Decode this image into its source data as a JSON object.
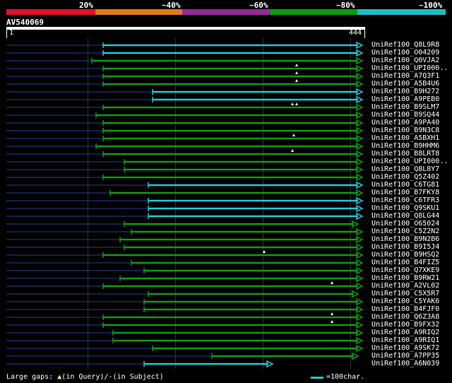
{
  "identity_header": {
    "labels": [
      "20%",
      "~40%",
      "~60%",
      "~80%",
      "~100%"
    ],
    "colors": [
      "#e4102c",
      "#e07a19",
      "#97289a",
      "#0c9a0c",
      "#1dbdc6"
    ]
  },
  "query": {
    "name": "AV540069",
    "start_label": "1",
    "end_label": "444"
  },
  "hits": [
    {
      "name": "UniRef100_Q8L9R8",
      "start": 146,
      "end": 513,
      "color": "cyan",
      "arrow": true
    },
    {
      "name": "UniRef100_O04209",
      "start": 146,
      "end": 513,
      "color": "cyan",
      "arrow": true
    },
    {
      "name": "UniRef100_Q0VJA2",
      "start": 130,
      "end": 513,
      "color": "green",
      "arrow": true
    },
    {
      "name": "UniRef100_UPI000..",
      "start": 146,
      "end": 513,
      "color": "green",
      "arrow": true,
      "marks": [
        420
      ]
    },
    {
      "name": "UniRef100_A7Q3F1",
      "start": 146,
      "end": 513,
      "color": "green",
      "arrow": true,
      "marks": [
        420
      ]
    },
    {
      "name": "UniRef100_A5B4U6",
      "start": 146,
      "end": 513,
      "color": "green",
      "arrow": true,
      "marks": [
        420
      ]
    },
    {
      "name": "UniRef100_B9H272",
      "start": 216,
      "end": 513,
      "color": "cyan",
      "arrow": true
    },
    {
      "name": "UniRef100_A9PEB0",
      "start": 216,
      "end": 513,
      "color": "cyan",
      "arrow": true
    },
    {
      "name": "UniRef100_B9SLM7",
      "start": 146,
      "end": 513,
      "color": "green",
      "arrow": true,
      "marks": [
        414,
        420
      ]
    },
    {
      "name": "UniRef100_B9SQ44",
      "start": 136,
      "end": 513,
      "color": "green",
      "arrow": true
    },
    {
      "name": "UniRef100_A9PA40",
      "start": 146,
      "end": 513,
      "color": "green",
      "arrow": true
    },
    {
      "name": "UniRef100_B9N3C8",
      "start": 146,
      "end": 513,
      "color": "green",
      "arrow": true
    },
    {
      "name": "UniRef100_A5BXH1",
      "start": 146,
      "end": 513,
      "color": "green",
      "arrow": true,
      "marks": [
        416
      ]
    },
    {
      "name": "UniRef100_B9HHM6",
      "start": 136,
      "end": 513,
      "color": "green",
      "arrow": true
    },
    {
      "name": "UniRef100_B8LRT8",
      "start": 146,
      "end": 513,
      "color": "green",
      "arrow": true,
      "marks": [
        414
      ]
    },
    {
      "name": "UniRef100_UPI000..",
      "start": 176,
      "end": 513,
      "color": "green",
      "arrow": true
    },
    {
      "name": "UniRef100_Q8L8Y7",
      "start": 176,
      "end": 513,
      "color": "green",
      "arrow": true
    },
    {
      "name": "UniRef100_Q5Z402",
      "start": 146,
      "end": 513,
      "color": "green",
      "arrow": true
    },
    {
      "name": "UniRef100_C6TG81",
      "start": 210,
      "end": 513,
      "color": "cyan",
      "arrow": true
    },
    {
      "name": "UniRef100_B7FKY8",
      "start": 156,
      "end": 513,
      "color": "green",
      "arrow": true
    },
    {
      "name": "UniRef100_C6TFR3",
      "start": 210,
      "end": 513,
      "color": "cyan",
      "arrow": true
    },
    {
      "name": "UniRef100_Q9SKU1",
      "start": 210,
      "end": 513,
      "color": "cyan",
      "arrow": true
    },
    {
      "name": "UniRef100_Q8LG44",
      "start": 210,
      "end": 513,
      "color": "cyan",
      "arrow": true
    },
    {
      "name": "UniRef100_O65024",
      "start": 176,
      "end": 507,
      "color": "green",
      "arrow": true
    },
    {
      "name": "UniRef100_C5Z2N2",
      "start": 186,
      "end": 513,
      "color": "green",
      "arrow": true
    },
    {
      "name": "UniRef100_B9N2B6",
      "start": 170,
      "end": 513,
      "color": "green",
      "arrow": true
    },
    {
      "name": "UniRef100_B9I5J4",
      "start": 176,
      "end": 513,
      "color": "green",
      "arrow": true
    },
    {
      "name": "UniRef100_B9HSQ2",
      "start": 146,
      "end": 513,
      "color": "green",
      "arrow": true,
      "marks": [
        374
      ]
    },
    {
      "name": "UniRef100_B4FIZ5",
      "start": 186,
      "end": 513,
      "color": "green",
      "arrow": true
    },
    {
      "name": "UniRef100_Q7XKE9",
      "start": 204,
      "end": 513,
      "color": "green",
      "arrow": true
    },
    {
      "name": "UniRef100_B9RW21",
      "start": 170,
      "end": 513,
      "color": "green",
      "arrow": true
    },
    {
      "name": "UniRef100_A2VL02",
      "start": 146,
      "end": 513,
      "color": "green",
      "arrow": true,
      "marks": [
        470
      ]
    },
    {
      "name": "UniRef100_C5X5R7",
      "start": 210,
      "end": 507,
      "color": "green",
      "arrow": true
    },
    {
      "name": "UniRef100_C5YAK6",
      "start": 204,
      "end": 513,
      "color": "green",
      "arrow": true
    },
    {
      "name": "UniRef100_B4FJF0",
      "start": 204,
      "end": 513,
      "color": "green",
      "arrow": true
    },
    {
      "name": "UniRef100_Q6Z3A8",
      "start": 146,
      "end": 513,
      "color": "green",
      "arrow": true,
      "marks": [
        470
      ]
    },
    {
      "name": "UniRef100_B9FX32",
      "start": 146,
      "end": 513,
      "color": "green",
      "arrow": true,
      "marks": [
        470
      ]
    },
    {
      "name": "UniRef100_A9RIQ2",
      "start": 160,
      "end": 513,
      "color": "green",
      "arrow": true
    },
    {
      "name": "UniRef100_A9RIQ1",
      "start": 160,
      "end": 513,
      "color": "green",
      "arrow": true
    },
    {
      "name": "UniRef100_A9SK72",
      "start": 216,
      "end": 513,
      "color": "green",
      "arrow": true
    },
    {
      "name": "UniRef100_A7PP35",
      "start": 300,
      "end": 507,
      "color": "green",
      "arrow": true
    },
    {
      "name": "UniRef100_A6N039",
      "start": 204,
      "end": 386,
      "color": "cyan",
      "arrow": true
    }
  ],
  "footer": {
    "gaps_label": "Large gaps: ",
    "query_label": "(in Query)/",
    "subject_label": "(in Subject)",
    "scale_label": "=100char."
  },
  "colors": {
    "cyan": "#23c7d2",
    "green": "#119a11",
    "dotted": "#1b2a66",
    "mark": "#ffffff"
  }
}
